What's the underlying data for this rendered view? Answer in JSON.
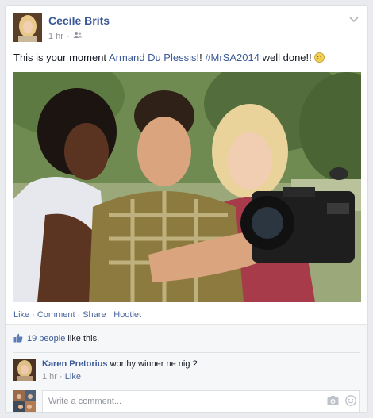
{
  "post": {
    "author": "Cecile Brits",
    "time": "1 hr",
    "audience_dot": "·",
    "audience_icon": "friends-icon",
    "text_intro": "This is your moment ",
    "mention": "Armand Du Plessis",
    "text_mid": "!! ",
    "hashtag": "#MrSA2014",
    "text_end": " well done!! ",
    "emoji": "smile-emoji"
  },
  "actions": {
    "like": "Like",
    "comment": "Comment",
    "share": "Share",
    "hootlet": "Hootlet",
    "sep": "·"
  },
  "feedback": {
    "likes_link": "19 people",
    "likes_suffix": " like this.",
    "comments": [
      {
        "name": "Karen Pretorius",
        "text": " worthy winner ne nig ?",
        "time": "1 hr",
        "dot": "·",
        "like": "Like"
      }
    ],
    "reply_placeholder": "Write a comment..."
  },
  "colors": {
    "link": "#3b5998",
    "muted": "#90949c",
    "background": "#e9ebee"
  }
}
